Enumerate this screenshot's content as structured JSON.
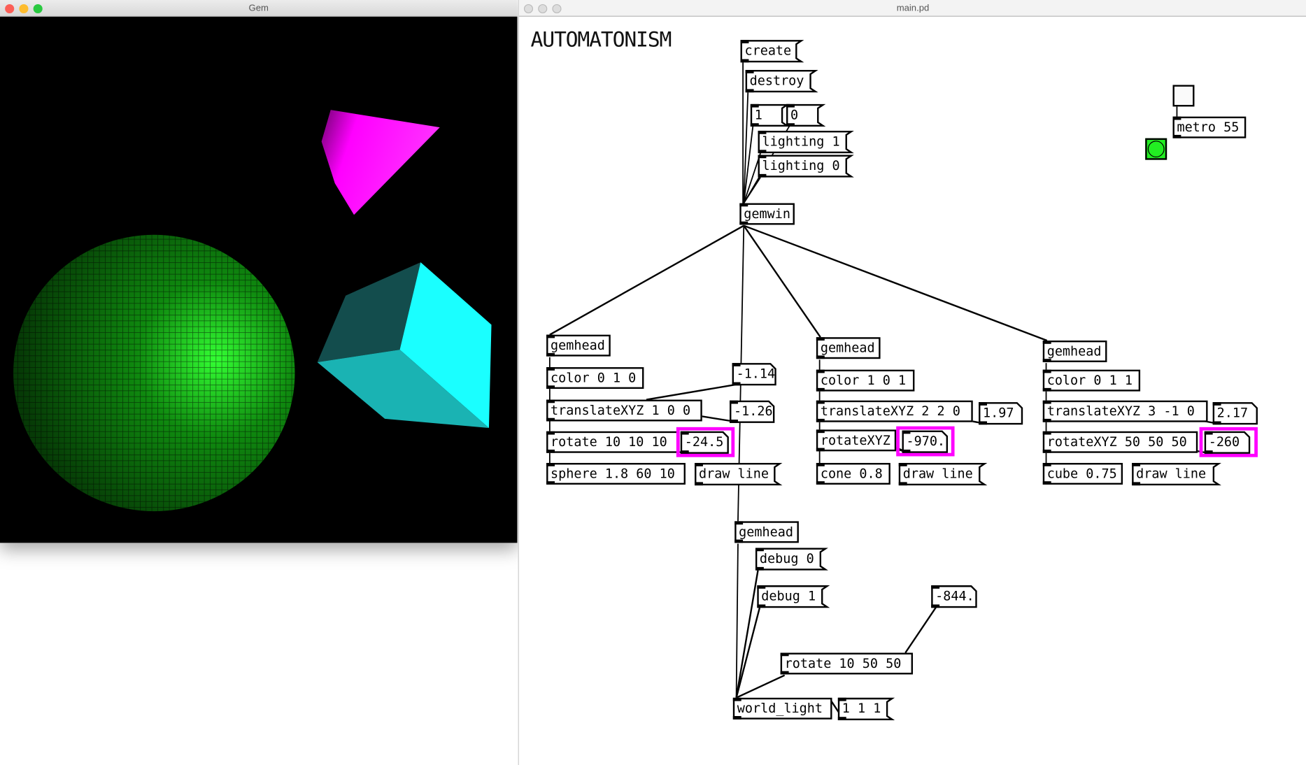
{
  "gem_window": {
    "title": "Gem",
    "background": "#000000",
    "scene": {
      "sphere_color": "#1fbf1f",
      "cone_color": "#ff00ff",
      "cube_color": "#1affff"
    }
  },
  "pd_window": {
    "title": "main.pd",
    "comment": "AUTOMATONISM"
  },
  "colors": {
    "highlight": "#ff00ff",
    "bang": "#22ee22"
  },
  "objects": {
    "create": "create",
    "destroy": "destroy",
    "one": "1",
    "zero": "0",
    "lighting1": "lighting 1",
    "lighting0": "lighting 0",
    "gemwin": "gemwin",
    "metro": "metro 55",
    "gemhead1": "gemhead",
    "color1": "color 0 1 0",
    "num1": "-1.14",
    "translate1": "translateXYZ 1 0 0",
    "num2": "-1.26",
    "rotate1": "rotate 10 10 10",
    "num3": "-24.5",
    "sphere": "sphere 1.8 60 10",
    "draw1": "draw line",
    "gemhead2": "gemhead",
    "color2": "color 1 0 1",
    "translate2": "translateXYZ 2 2 0",
    "num4": "1.97",
    "rotate2": "rotateXYZ",
    "num5": "-970.",
    "cone": "cone 0.8",
    "draw2": "draw line",
    "gemhead3": "gemhead",
    "color3": "color 0 1 1",
    "translate3": "translateXYZ 3 -1 0",
    "num6": "2.17",
    "rotate3": "rotateXYZ 50 50 50",
    "num7": "-260",
    "cube": "cube 0.75",
    "draw3": "draw line",
    "gemhead4": "gemhead",
    "debug0": "debug 0",
    "debug1": "debug 1",
    "num8": "-844.",
    "rotate4": "rotate 10 50 50",
    "world_light": "world_light",
    "msg111": "1 1 1"
  }
}
